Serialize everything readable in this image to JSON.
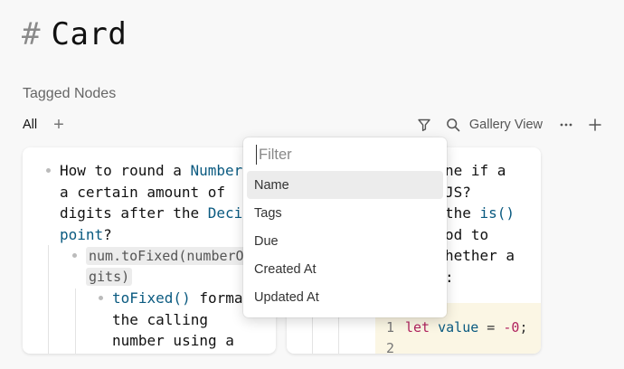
{
  "page": {
    "hash_symbol": "#",
    "title": "Card"
  },
  "section": {
    "label": "Tagged Nodes"
  },
  "tabs": {
    "all_label": "All",
    "add_symbol": "+"
  },
  "toolbar": {
    "view_label": "Gallery View",
    "more_symbol": "···",
    "add_symbol": "+"
  },
  "card1": {
    "q_line1_a": "How to round a ",
    "q_line1_b": "Number",
    "q_line2": "a certain amount of",
    "q_line3_a": "digits after the ",
    "q_line3_b": "Decim",
    "q_line4_a": "point",
    "q_line4_b": "?",
    "code_line1": "num.toFixed(numberOfDi",
    "code_line2": "gits)",
    "sub_line1_a": "toFixed()",
    "sub_line1_b": " format",
    "sub_line2": "the calling",
    "sub_line3": "number using a"
  },
  "card2": {
    "line1": "ne if a",
    "line2": "JS?",
    "line3_a": "the ",
    "line3_b": "is()",
    "line4": "od to",
    "line5": "hether a",
    "line6": ":",
    "code": {
      "line1_no": "1",
      "line2_no": "2",
      "kw_let": "let",
      "var_name": "value",
      "op": " = ",
      "num": "-0",
      "semi": ";"
    }
  },
  "dropdown": {
    "placeholder": "Filter",
    "options": [
      "Name",
      "Tags",
      "Due",
      "Created At",
      "Updated At"
    ],
    "selected": "Name"
  },
  "icons": {
    "filter": "filter-icon",
    "search": "search-icon",
    "more": "more-icon",
    "add": "plus-icon"
  }
}
